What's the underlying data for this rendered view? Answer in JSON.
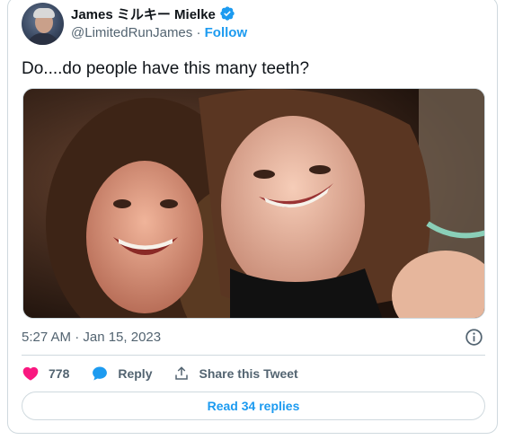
{
  "author": {
    "name": "James ミルキー Mielke",
    "handle": "@LimitedRunJames",
    "separator": "·",
    "follow_label": "Follow",
    "verified_icon": "verified-badge-icon"
  },
  "tweet": {
    "text": "Do....do people have this many teeth?",
    "timestamp": "5:27 AM · Jan 15, 2023"
  },
  "actions": {
    "like_count": "778",
    "reply_label": "Reply",
    "share_label": "Share this Tweet"
  },
  "footer": {
    "read_replies_label": "Read 34 replies"
  },
  "colors": {
    "accent": "#1d9bf0",
    "like": "#f91880",
    "muted": "#536471",
    "border": "#cfd9de"
  }
}
